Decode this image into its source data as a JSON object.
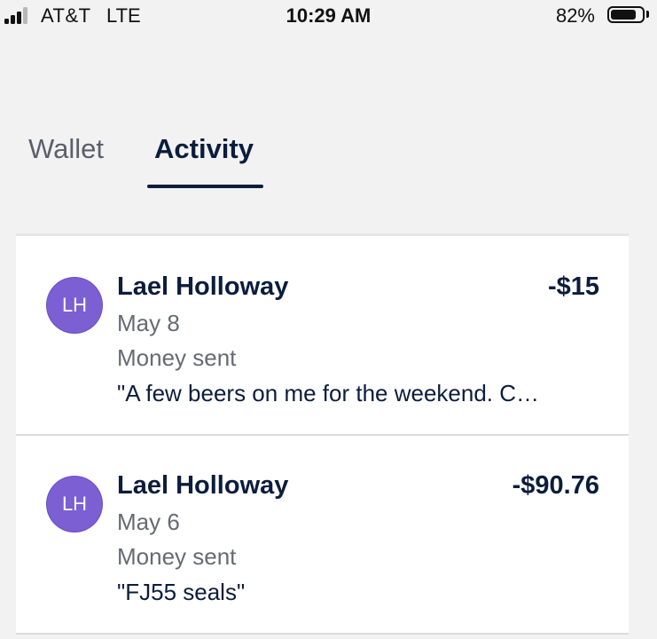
{
  "status_bar": {
    "carrier": "AT&T",
    "network": "LTE",
    "time": "10:29 AM",
    "battery_percent": "82%",
    "battery_level": 0.82
  },
  "tabs": [
    {
      "label": "Wallet",
      "selected": false
    },
    {
      "label": "Activity",
      "selected": true
    }
  ],
  "transactions": [
    {
      "initials": "LH",
      "name": "Lael Holloway",
      "amount": "-$15",
      "date": "May 8",
      "type": "Money sent",
      "note": "\"A few beers on me for the weekend.   C…"
    },
    {
      "initials": "LH",
      "name": "Lael Holloway",
      "amount": "-$90.76",
      "date": "May 6",
      "type": "Money sent",
      "note": "\"FJ55 seals\""
    }
  ],
  "colors": {
    "accent": "#0b1d3d",
    "avatar": "#7b5fd3",
    "background": "#f2f2f2"
  }
}
